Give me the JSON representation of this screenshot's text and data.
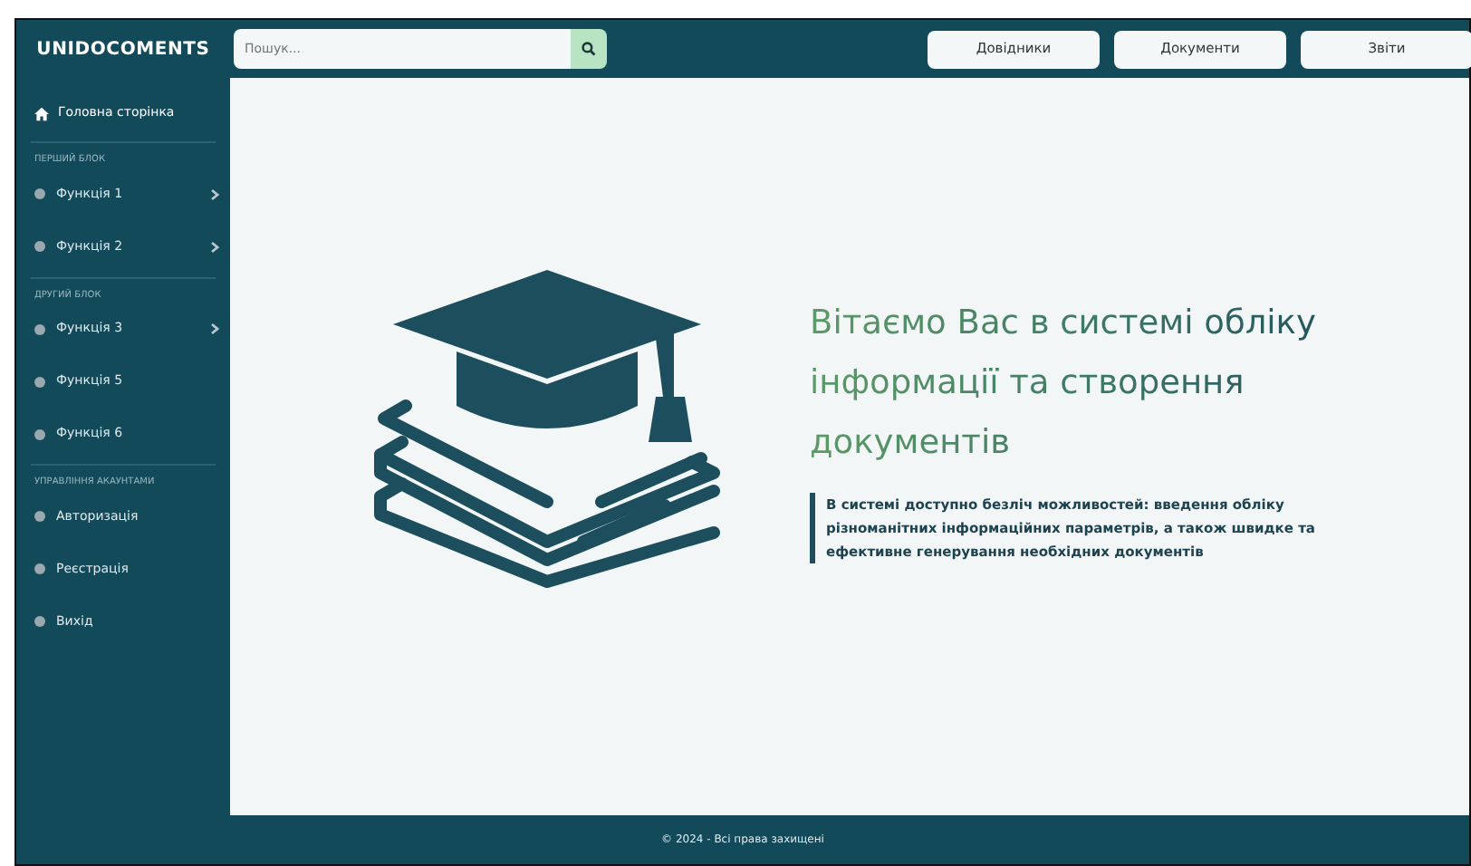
{
  "brand": "UNIDOCOMENTS",
  "search": {
    "placeholder": "Пошук..."
  },
  "nav_buttons": [
    "Довідники",
    "Документи",
    "Звіти"
  ],
  "sidebar": {
    "home": "Головна сторінка",
    "sections": [
      {
        "title": "ПЕРШИЙ БЛОК",
        "items": [
          {
            "label": "Функція 1",
            "expandable": true
          },
          {
            "label": "Функція 2",
            "expandable": true
          }
        ]
      },
      {
        "title": "ДРУГИЙ БЛОК",
        "items": [
          {
            "label": "Функція 3",
            "expandable": true
          },
          {
            "label": "Функція 5",
            "expandable": false
          },
          {
            "label": "Функція 6",
            "expandable": false
          }
        ]
      },
      {
        "title": "УПРАВЛІННЯ АКАУНТАМИ",
        "items": [
          {
            "label": "Авторизація",
            "expandable": false
          },
          {
            "label": "Реєстрація",
            "expandable": false
          },
          {
            "label": "Вихід",
            "expandable": false
          }
        ]
      }
    ]
  },
  "hero": {
    "title": "Вітаємо Вас в системі обліку інформації та створення документів",
    "text": "В системі доступно безліч можливостей: введення обліку різноманітних інформаційних параметрів, а також швидке та ефективне генерування необхідних документів"
  },
  "footer": "© 2024 - Всі права захищені"
}
